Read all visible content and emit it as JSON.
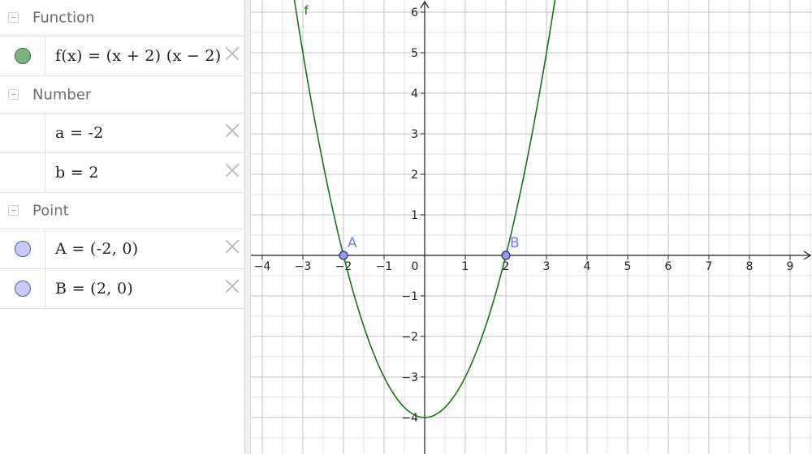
{
  "algebra": {
    "groups": {
      "function": {
        "label": "Function"
      },
      "number": {
        "label": "Number"
      },
      "point": {
        "label": "Point"
      }
    },
    "items": {
      "f": {
        "text": "f(x) = (x + 2) (x − 2)",
        "color": "#7fb27f"
      },
      "a": {
        "text": "a = -2"
      },
      "b": {
        "text": "b = 2"
      },
      "A": {
        "text": "A = (-2, 0)",
        "color": "#c9c9f5"
      },
      "B": {
        "text": "B = (2, 0)",
        "color": "#c9c9f5"
      }
    }
  },
  "chart_data": {
    "type": "line",
    "x_ticks": [
      "−4",
      "−3",
      "−2",
      "−1",
      "0",
      "1",
      "2",
      "3",
      "4",
      "5",
      "6",
      "7",
      "8",
      "9"
    ],
    "x_tick_values": [
      -4,
      -3,
      -2,
      -1,
      0,
      1,
      2,
      3,
      4,
      5,
      6,
      7,
      8,
      9
    ],
    "y_ticks": [
      "6",
      "5",
      "4",
      "3",
      "2",
      "1",
      "−1",
      "−2",
      "−3",
      "−4"
    ],
    "y_tick_values": [
      6,
      5,
      4,
      3,
      2,
      1,
      -1,
      -2,
      -3,
      -4
    ],
    "xlim": [
      -4.3,
      9.5
    ],
    "ylim": [
      -4.85,
      6.3
    ],
    "grid": true,
    "curve": {
      "label": "f",
      "formula": "(x + 2)(x - 2)",
      "color": "#1f6f1f"
    },
    "points": [
      {
        "label": "A",
        "x": -2,
        "y": 0,
        "color": "#7a7ae6"
      },
      {
        "label": "B",
        "x": 2,
        "y": 0,
        "color": "#7a7ae6"
      }
    ],
    "origin_label": "0"
  }
}
